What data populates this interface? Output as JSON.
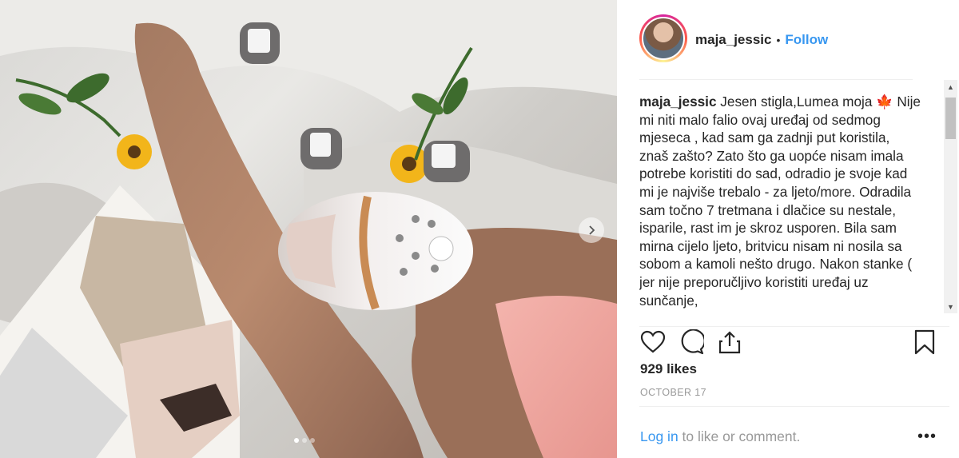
{
  "post": {
    "username": "maja_jessic",
    "separator": "•",
    "follow_label": "Follow",
    "caption_username": "maja_jessic",
    "caption_text": " Jesen stigla,Lumea moja 🍁 Nije mi niti malo falio ovaj uređaj od sedmog mjeseca , kad sam ga zadnji put koristila, znaš zašto? Zato što ga uopće nisam imala potrebe koristiti do sad, odradio je svoje kad mi je najviše trebalo - za ljeto/more. Odradila sam točno 7 tretmana i dlačice su nestale, isparile, rast im je skroz usporen. Bila sam mirna cijelo ljeto, britvicu nisam ni nosila sa sobom a kamoli nešto drugo. Nakon stanke ( jer nije preporučljivo koristiti uređaj uz sunčanje,",
    "likes": "929 likes",
    "date": "OCTOBER 17",
    "login_link": "Log in",
    "login_rest": " to like or comment.",
    "more_label": "•••"
  },
  "icons": {
    "like": "heart-icon",
    "comment": "comment-icon",
    "share": "share-icon",
    "save": "bookmark-icon",
    "next": "chevron-right-icon"
  },
  "carousel": {
    "count": 3,
    "active": 1
  },
  "colors": {
    "accent": "#3897f0",
    "text": "#262626",
    "muted": "#999999"
  }
}
